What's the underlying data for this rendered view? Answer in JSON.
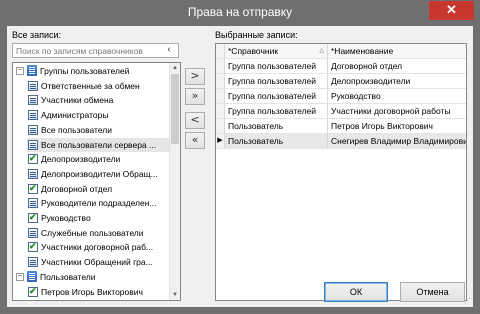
{
  "window": {
    "title": "Права на отправку",
    "close_glyph": "✕"
  },
  "left": {
    "label": "Все записи:",
    "search_placeholder": "Поиск по записям справочников",
    "search_clear_glyph": "‹",
    "tree": [
      {
        "type": "group",
        "label": "Группы пользователей",
        "expander": "−",
        "icon": "user-group-icon"
      },
      {
        "type": "item",
        "label": "Ответственные за обмен",
        "checked": false
      },
      {
        "type": "item",
        "label": "Участники обмена",
        "checked": false
      },
      {
        "type": "item",
        "label": "Администраторы",
        "checked": false
      },
      {
        "type": "item",
        "label": "Все пользователи",
        "checked": false
      },
      {
        "type": "item",
        "label": "Все пользователи сервера ...",
        "checked": false,
        "selected": true
      },
      {
        "type": "item",
        "label": "Делопроизводители",
        "checked": true
      },
      {
        "type": "item",
        "label": "Делопроизводители Обращ...",
        "checked": false
      },
      {
        "type": "item",
        "label": "Договорной отдел",
        "checked": true
      },
      {
        "type": "item",
        "label": "Руководители подразделен...",
        "checked": false
      },
      {
        "type": "item",
        "label": "Руководство",
        "checked": true
      },
      {
        "type": "item",
        "label": "Служебные пользователи",
        "checked": false
      },
      {
        "type": "item",
        "label": "Участники договорной раб...",
        "checked": true
      },
      {
        "type": "item",
        "label": "Участники Обращений гра...",
        "checked": false
      },
      {
        "type": "group",
        "label": "Пользователи",
        "expander": "−",
        "icon": "users-icon"
      },
      {
        "type": "item",
        "label": "Петров Игорь Викторович",
        "checked": true
      }
    ],
    "scroll_up_glyph": "▲",
    "scroll_down_glyph": "▼"
  },
  "move_buttons": {
    "add": ">",
    "add_all": "»",
    "remove": "<",
    "remove_all": "«"
  },
  "right": {
    "label": "Выбранные записи:",
    "columns": [
      "*Справочник",
      "*Наименование"
    ],
    "sort_glyph": "△",
    "current_row_glyph": "▶",
    "rows": [
      {
        "directory": "Группа пользователей",
        "name": "Договорной отдел"
      },
      {
        "directory": "Группа пользователей",
        "name": "Делопроизводители"
      },
      {
        "directory": "Группа пользователей",
        "name": "Руководство"
      },
      {
        "directory": "Группа пользователей",
        "name": "Участники договорной работы"
      },
      {
        "directory": "Пользователь",
        "name": "Петров Игорь Викторович"
      },
      {
        "directory": "Пользователь",
        "name": "Снегирев Владимир Владимирович",
        "current": true
      }
    ]
  },
  "buttons": {
    "ok": "ОК",
    "cancel": "Отмена"
  }
}
